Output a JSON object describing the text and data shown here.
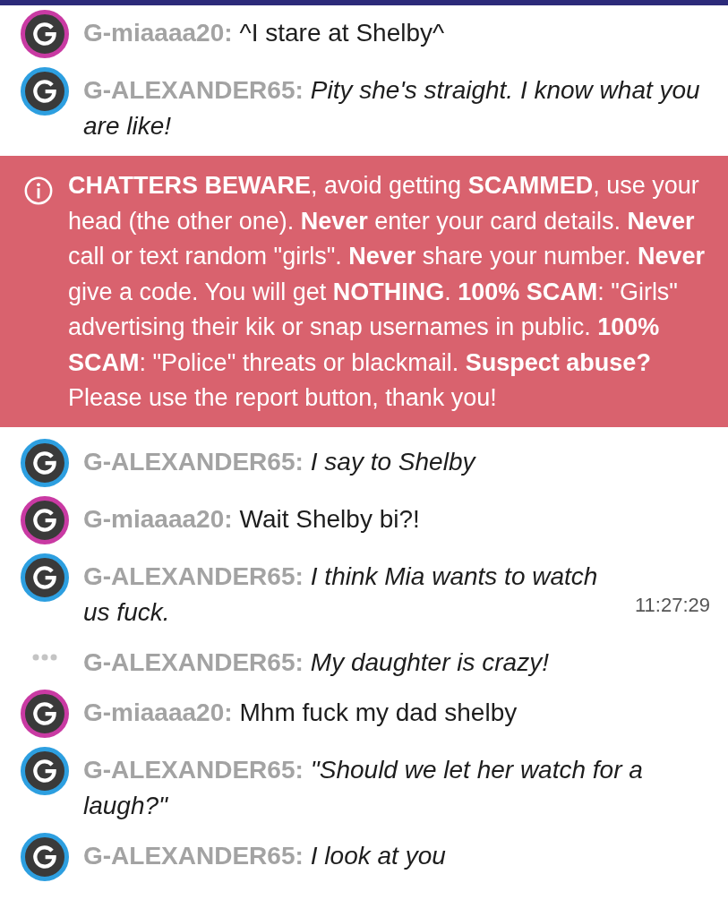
{
  "feed": [
    {
      "kind": "message",
      "color": "#c93aa3",
      "name": "G-miaaaa20:",
      "text": "^I stare at Shelby^",
      "italic": false
    },
    {
      "kind": "message",
      "color": "#2d9fe0",
      "name": "G-ALEXANDER65:",
      "text": "Pity she's straight. I know what you are like!",
      "italic": true
    },
    {
      "kind": "notice",
      "text": "**CHATTERS BEWARE**, avoid getting **SCAMMED**, use your head (the other one). **Never** enter your card details. **Never** call or text random \"girls\". **Never** share your number. **Never** give a code. You will get **NOTHING**. **100% SCAM**: \"Girls\" advertising their kik or snap usernames in public. **100% SCAM**: \"Police\" threats or blackmail. **Suspect abuse?** Please use the report button, thank you!"
    },
    {
      "kind": "message",
      "color": "#2d9fe0",
      "name": "G-ALEXANDER65:",
      "text": "I say to Shelby",
      "italic": true
    },
    {
      "kind": "message",
      "color": "#c93aa3",
      "name": "G-miaaaa20:",
      "text": "Wait Shelby bi?!",
      "italic": false
    },
    {
      "kind": "message",
      "color": "#2d9fe0",
      "name": "G-ALEXANDER65:",
      "text": "I think Mia wants to watch us fuck.",
      "italic": true,
      "time": "11:27:29"
    },
    {
      "kind": "pending",
      "name": "G-ALEXANDER65:",
      "text": "My daughter is crazy!",
      "italic": true
    },
    {
      "kind": "message",
      "color": "#c93aa3",
      "name": "G-miaaaa20:",
      "text": "Mhm fuck my dad shelby",
      "italic": false
    },
    {
      "kind": "message",
      "color": "#2d9fe0",
      "name": "G-ALEXANDER65:",
      "text": "\"Should we let her watch for a laugh?\"",
      "italic": true
    },
    {
      "kind": "message",
      "color": "#2d9fe0",
      "name": "G-ALEXANDER65:",
      "text": "I look at you",
      "italic": true
    }
  ]
}
